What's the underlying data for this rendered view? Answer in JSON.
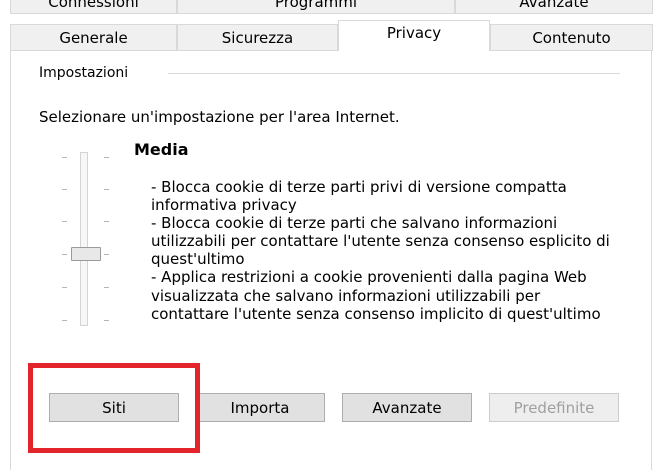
{
  "tabs_top": [
    "Connessioni",
    "Programmi",
    "Avanzate"
  ],
  "tabs": [
    {
      "label": "Generale",
      "selected": false
    },
    {
      "label": "Sicurezza",
      "selected": false
    },
    {
      "label": "Privacy",
      "selected": true
    },
    {
      "label": "Contenuto",
      "selected": false
    }
  ],
  "settings": {
    "group_label": "Impostazioni",
    "prompt": "Selezionare un'impostazione per l'area Internet.",
    "level_title": "Media",
    "slider_level": "Media",
    "description_lines": [
      "- Blocca cookie di terze parti privi di versione compatta",
      "informativa privacy",
      "- Blocca cookie di terze parti che salvano informazioni",
      "utilizzabili per contattare l'utente senza consenso esplicito di",
      "quest'ultimo",
      "- Applica restrizioni a cookie provenienti dalla pagina Web",
      "visualizzata che salvano informazioni utilizzabili per",
      "contattare l'utente senza consenso implicito di quest'ultimo"
    ]
  },
  "buttons": {
    "sites": "Siti",
    "import": "Importa",
    "advanced": "Avanzate",
    "default": "Predefinite"
  },
  "highlight_color": "#e3242b"
}
